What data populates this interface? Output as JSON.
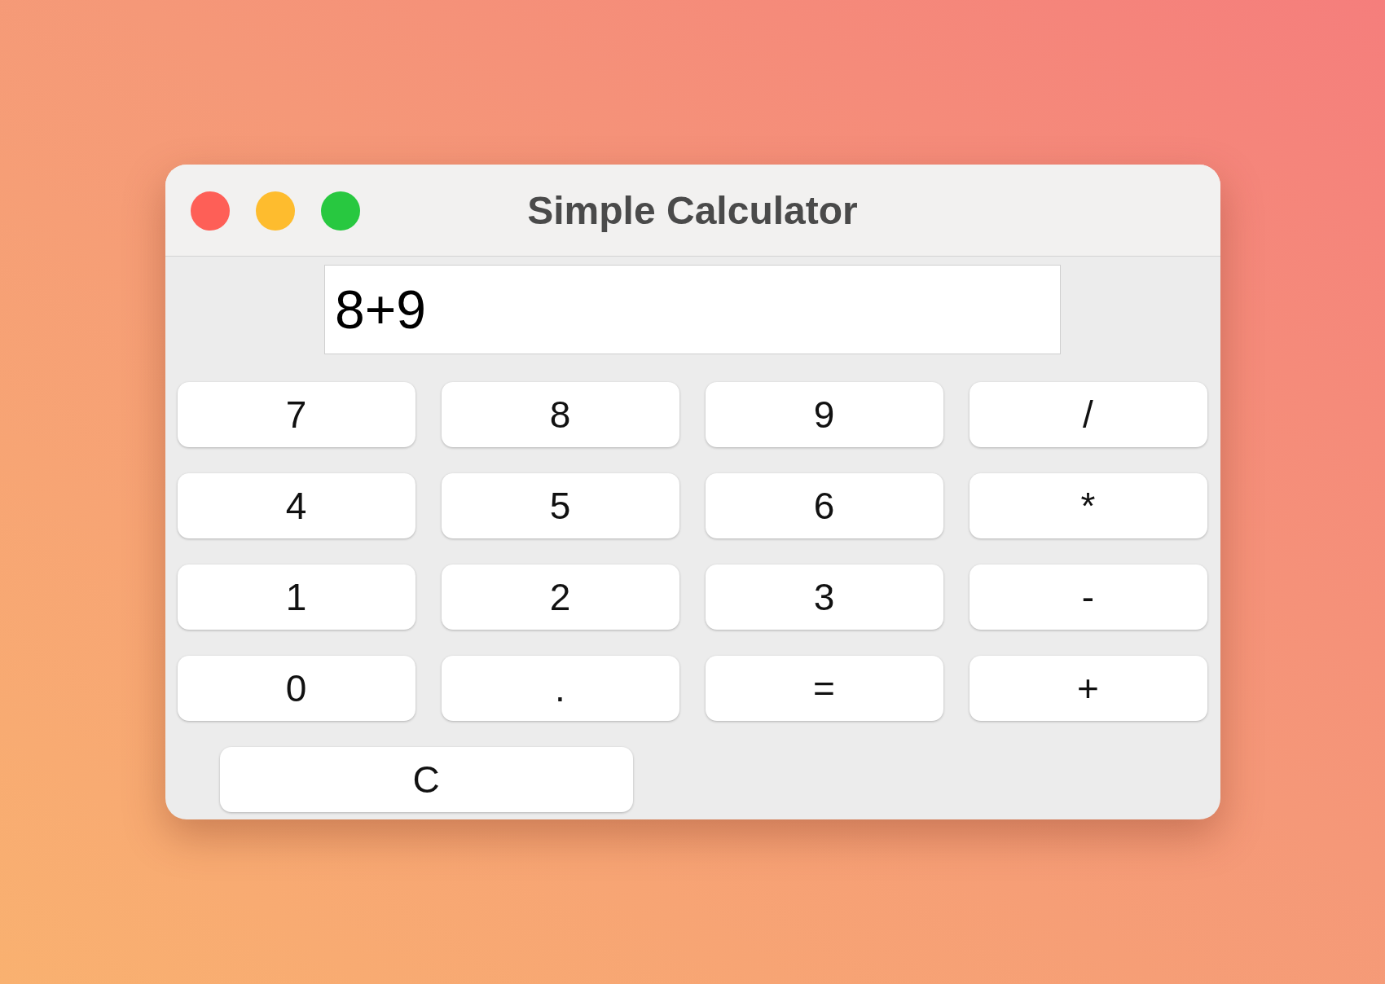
{
  "window": {
    "title": "Simple Calculator"
  },
  "display": {
    "value": "8+9"
  },
  "keys": [
    "7",
    "8",
    "9",
    "/",
    "4",
    "5",
    "6",
    "*",
    "1",
    "2",
    "3",
    "-",
    "0",
    ".",
    "=",
    "+"
  ],
  "clear_button": "C"
}
